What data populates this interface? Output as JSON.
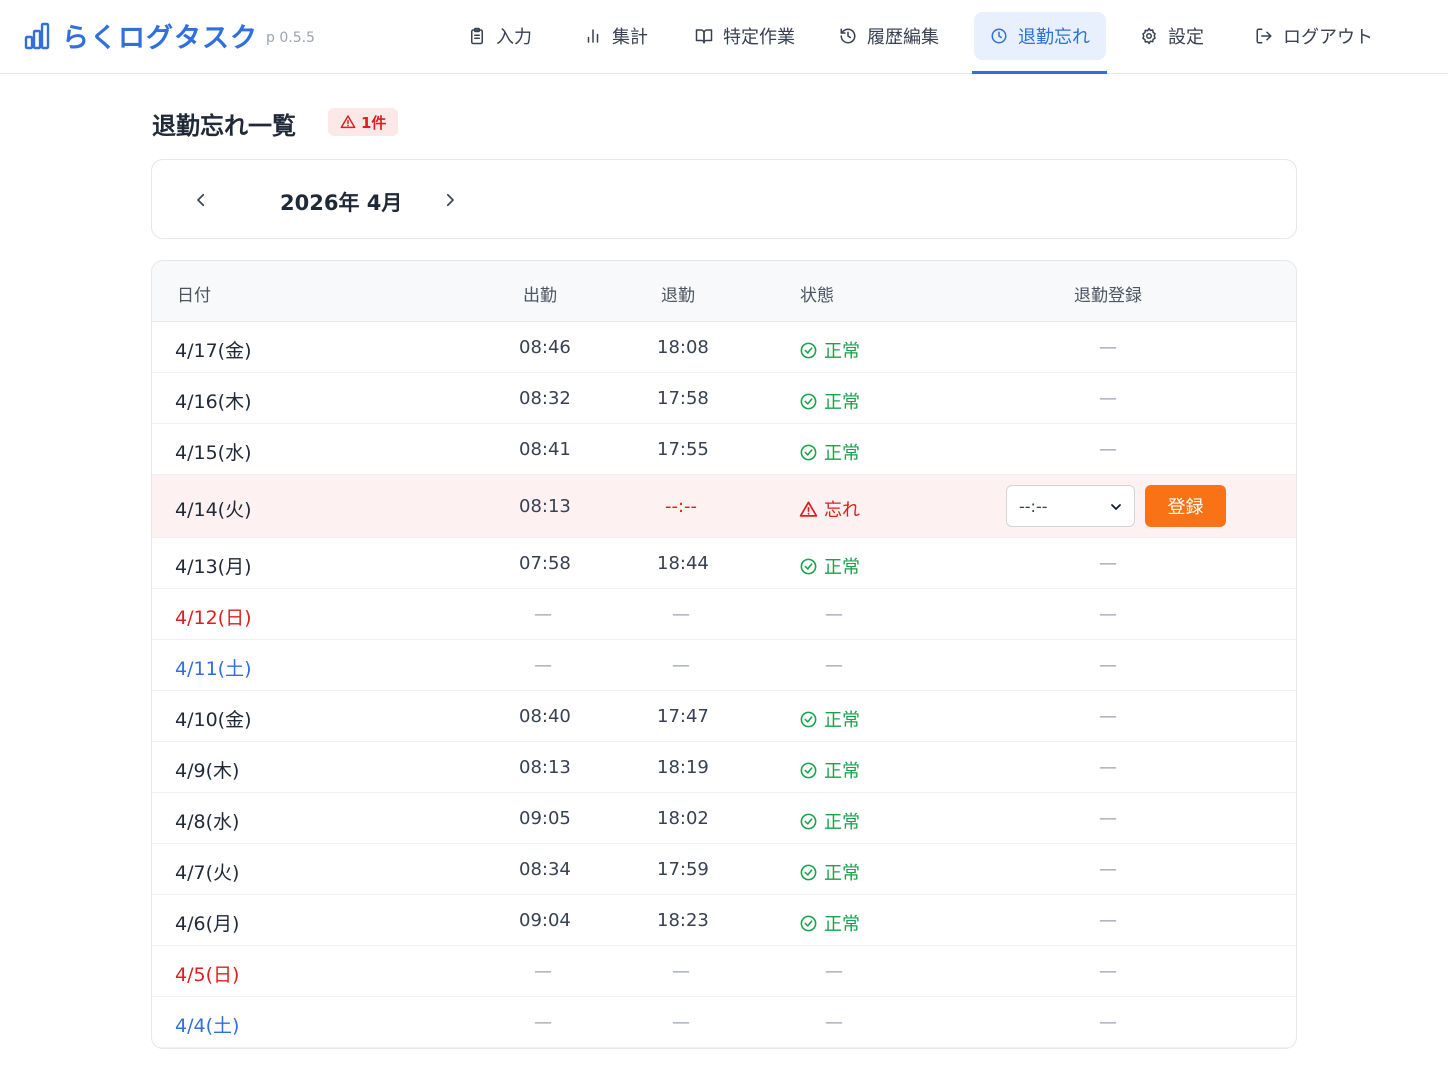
{
  "app": {
    "name": "らくログタスク",
    "version": "p 0.5.5",
    "accent_color": "#2f6fde",
    "warning_color": "#e11d1d",
    "ok_color": "#16a34a",
    "button_color": "#f97316",
    "brand_icon": "bar-chart-icon"
  },
  "nav": {
    "items": [
      {
        "label": "入力",
        "icon": "clipboard-icon"
      },
      {
        "label": "集計",
        "icon": "bar-chart-icon"
      },
      {
        "label": "特定作業",
        "icon": "book-open-icon"
      },
      {
        "label": "履歴編集",
        "icon": "history-icon"
      },
      {
        "label": "退勤忘れ",
        "icon": "clock-icon",
        "active": true
      },
      {
        "label": "設定",
        "icon": "gear-icon"
      },
      {
        "label": "ログアウト",
        "icon": "logout-icon"
      }
    ]
  },
  "page": {
    "title": "退勤忘れ一覧",
    "badge": "1件",
    "badge_icon": "warning-triangle-icon"
  },
  "month": {
    "label": "2026年 4月",
    "prev_icon": "chevron-left-icon",
    "next_icon": "chevron-right-icon"
  },
  "table": {
    "headers": {
      "date": "日付",
      "clock_in": "出勤",
      "clock_out": "退勤",
      "status": "状態",
      "register": "退勤登録"
    },
    "rows": [
      {
        "date": "4/17(金)",
        "day_type": "weekday",
        "in": "08:46",
        "out": "18:08",
        "status": "正常",
        "status_type": "ok",
        "register": "—"
      },
      {
        "date": "4/16(木)",
        "day_type": "weekday",
        "in": "08:32",
        "out": "17:58",
        "status": "正常",
        "status_type": "ok",
        "register": "—"
      },
      {
        "date": "4/15(水)",
        "day_type": "weekday",
        "in": "08:41",
        "out": "17:55",
        "status": "正常",
        "status_type": "ok",
        "register": "—"
      },
      {
        "date": "4/14(火)",
        "day_type": "weekday",
        "in": "08:13",
        "out": "--:--",
        "status": "忘れ",
        "status_type": "forgot",
        "register_select": "--:--",
        "register_button": "登録"
      },
      {
        "date": "4/13(月)",
        "day_type": "weekday",
        "in": "07:58",
        "out": "18:44",
        "status": "正常",
        "status_type": "ok",
        "register": "—"
      },
      {
        "date": "4/12(日)",
        "day_type": "sunday",
        "in": "—",
        "out": "—",
        "status": "—",
        "status_type": "none",
        "register": "—"
      },
      {
        "date": "4/11(土)",
        "day_type": "saturday",
        "in": "—",
        "out": "—",
        "status": "—",
        "status_type": "none",
        "register": "—"
      },
      {
        "date": "4/10(金)",
        "day_type": "weekday",
        "in": "08:40",
        "out": "17:47",
        "status": "正常",
        "status_type": "ok",
        "register": "—"
      },
      {
        "date": "4/9(木)",
        "day_type": "weekday",
        "in": "08:13",
        "out": "18:19",
        "status": "正常",
        "status_type": "ok",
        "register": "—"
      },
      {
        "date": "4/8(水)",
        "day_type": "weekday",
        "in": "09:05",
        "out": "18:02",
        "status": "正常",
        "status_type": "ok",
        "register": "—"
      },
      {
        "date": "4/7(火)",
        "day_type": "weekday",
        "in": "08:34",
        "out": "17:59",
        "status": "正常",
        "status_type": "ok",
        "register": "—"
      },
      {
        "date": "4/6(月)",
        "day_type": "weekday",
        "in": "09:04",
        "out": "18:23",
        "status": "正常",
        "status_type": "ok",
        "register": "—"
      },
      {
        "date": "4/5(日)",
        "day_type": "sunday",
        "in": "—",
        "out": "—",
        "status": "—",
        "status_type": "none",
        "register": "—"
      },
      {
        "date": "4/4(土)",
        "day_type": "saturday",
        "in": "—",
        "out": "—",
        "status": "—",
        "status_type": "none",
        "register": "—"
      }
    ]
  }
}
